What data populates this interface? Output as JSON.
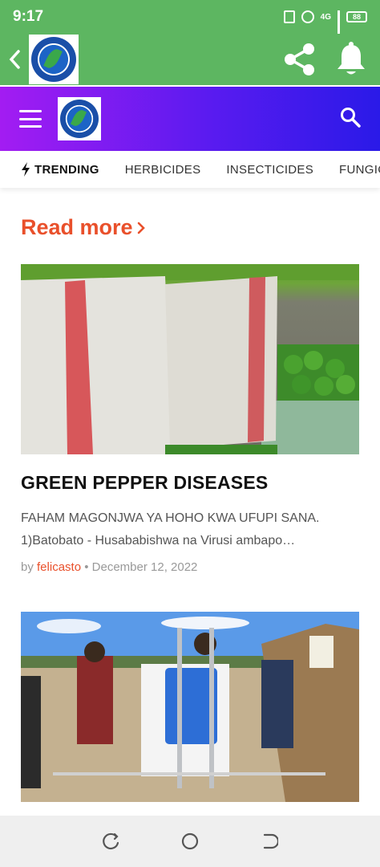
{
  "status": {
    "time": "9:17",
    "network": "4G",
    "battery": "88"
  },
  "appbar": {
    "back_icon": "chevron-left-icon",
    "share_icon": "share-icon",
    "bell_icon": "bell-icon",
    "colors": {
      "bar": "#5db661"
    }
  },
  "site": {
    "menu_icon": "hamburger-menu-icon",
    "search_icon": "search-icon",
    "gradient": [
      "#a31cf2",
      "#2a1ae8"
    ]
  },
  "nav": {
    "tabs": [
      {
        "label": "TRENDING"
      },
      {
        "label": "HERBICIDES"
      },
      {
        "label": "INSECTICIDES"
      },
      {
        "label": "FUNGIC"
      }
    ]
  },
  "content": {
    "section_title": "Read more",
    "accent": "#e9502b",
    "posts": [
      {
        "title": "GREEN PEPPER DISEASES",
        "excerpt": "FAHAM MAGONJWA YA HOHO KWA UFUPI SANA. 1)Batobato - Husababishwa na Virusi ambapo…",
        "by": "by",
        "author": "felicasto",
        "separator": "•",
        "date": "December 12, 2022"
      }
    ]
  }
}
